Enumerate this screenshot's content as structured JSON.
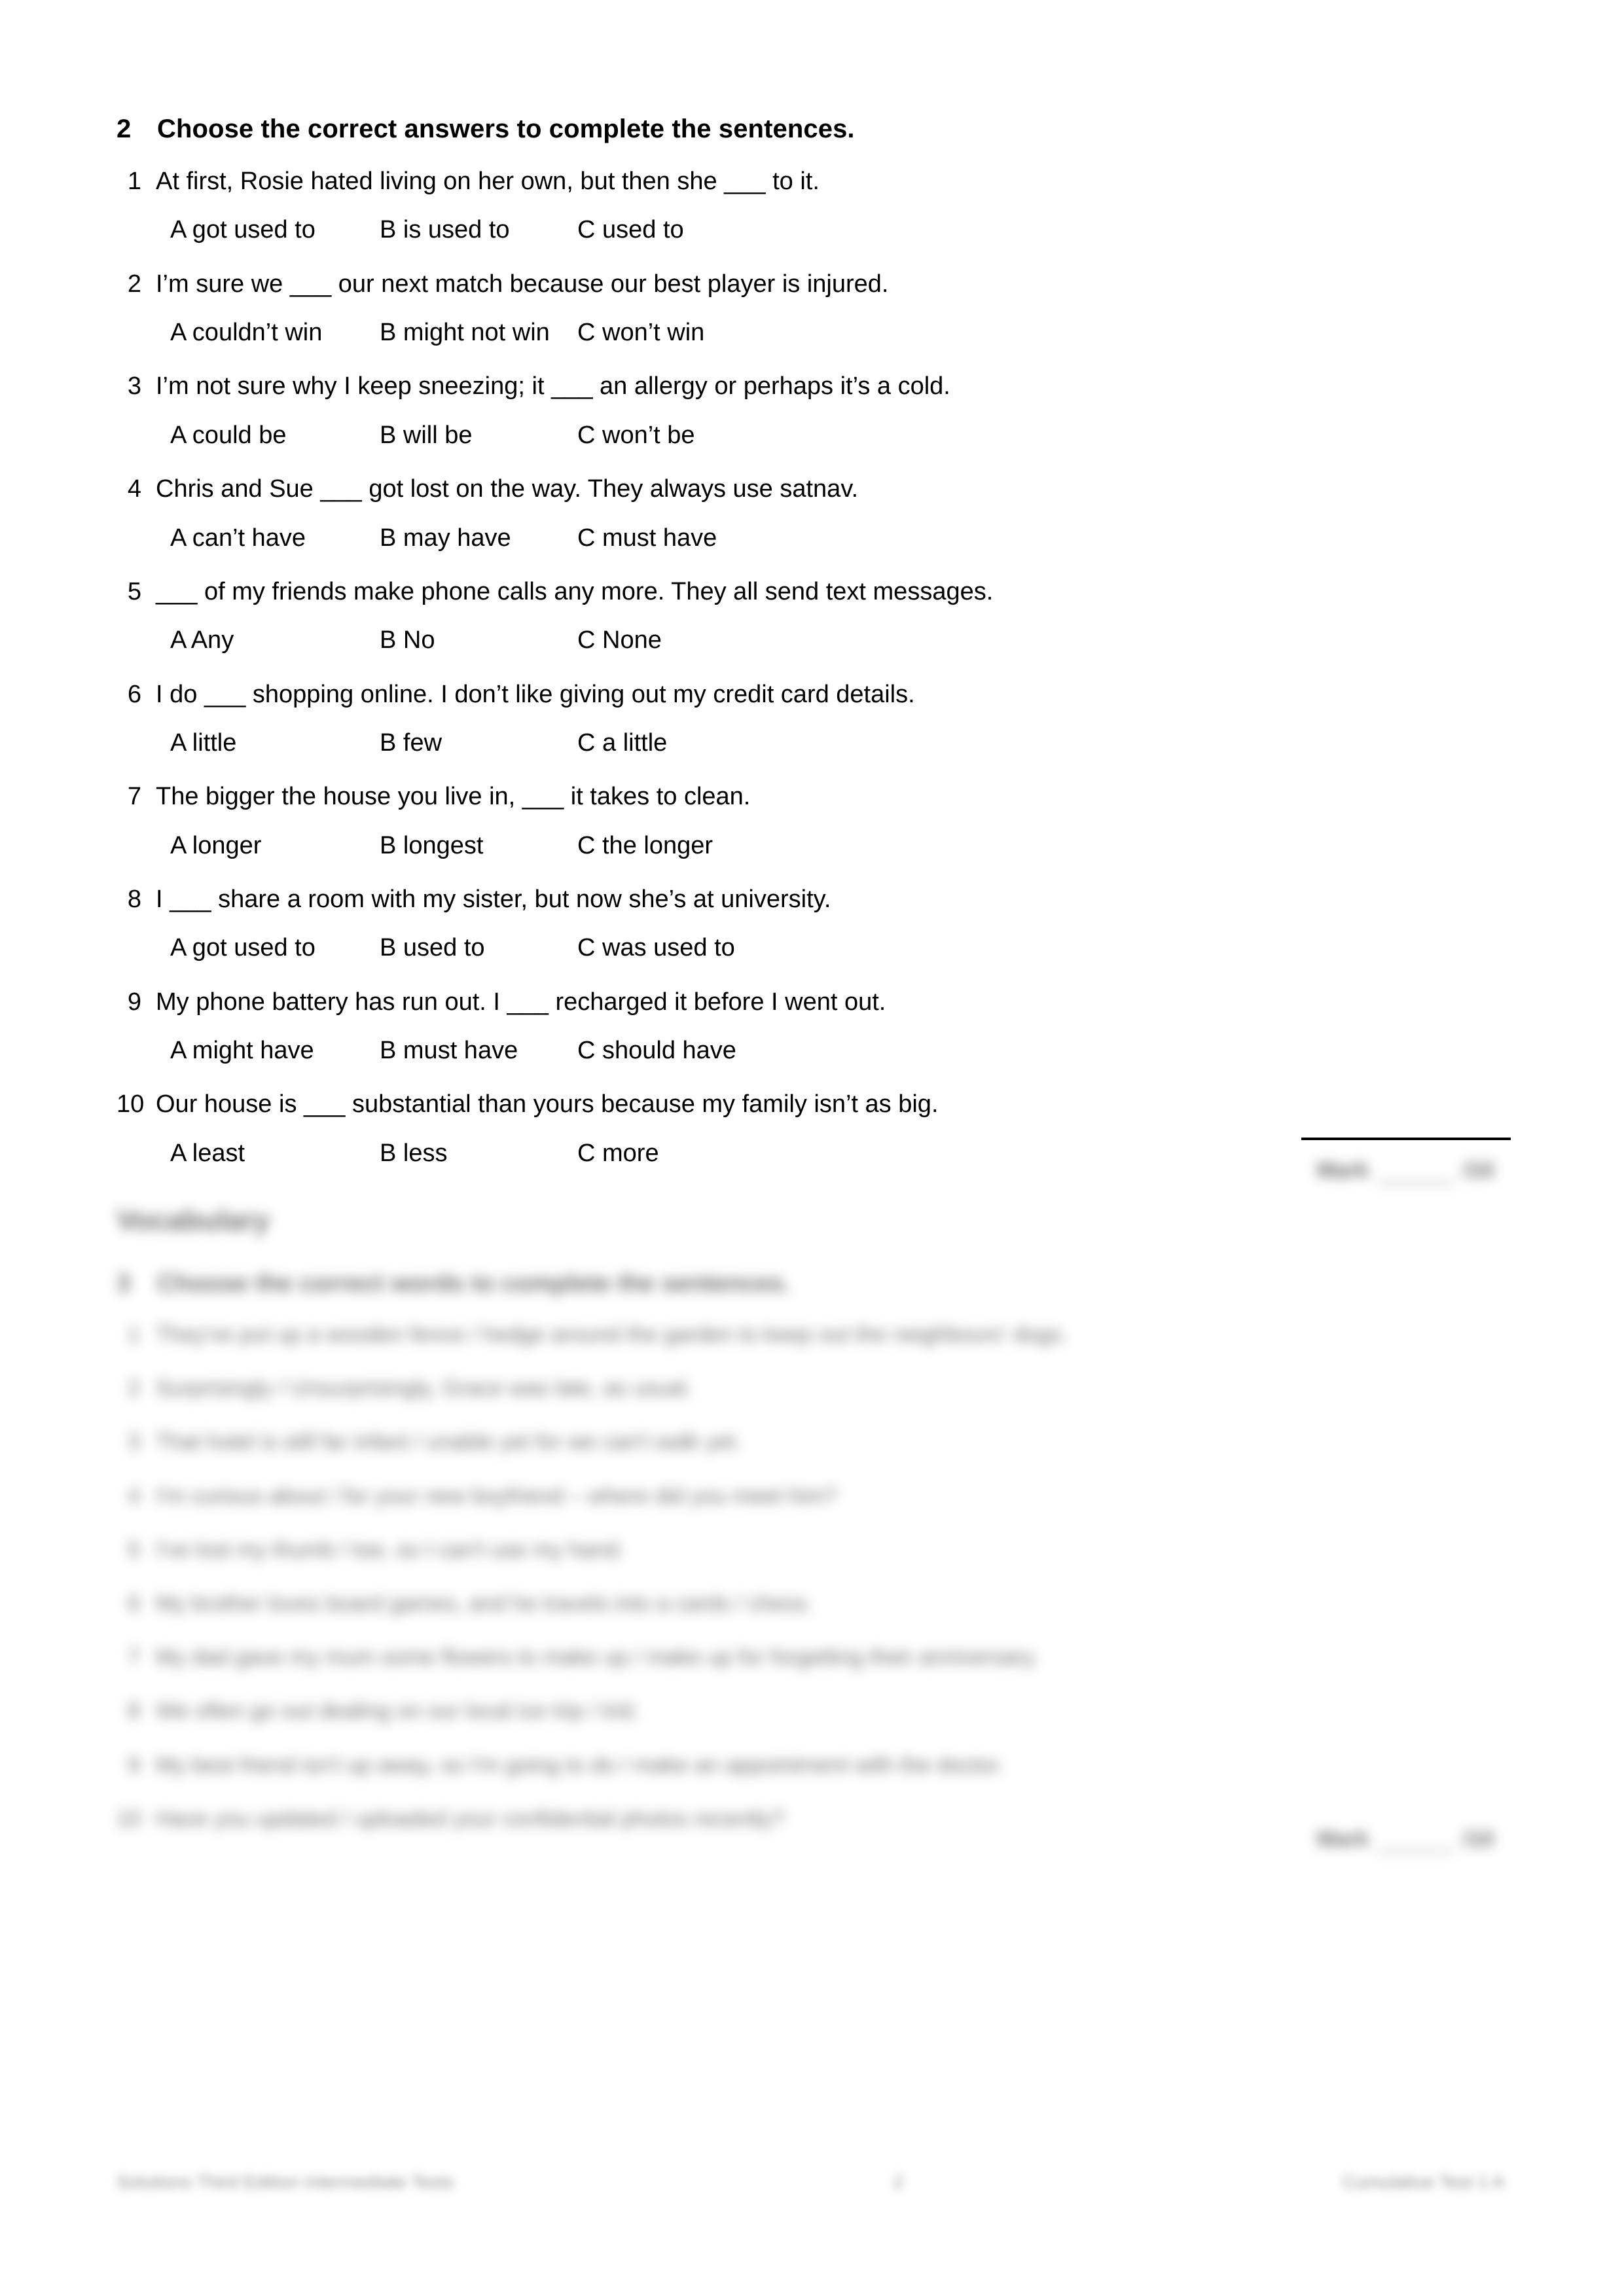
{
  "exercise2": {
    "number": "2",
    "title": "Choose the correct answers to complete the sentences.",
    "questions": [
      {
        "num": "1",
        "text": "At first, Rosie hated living on her own, but then she ___ to it.",
        "a": "A got used to",
        "b": "B is used to",
        "c": "C used to"
      },
      {
        "num": "2",
        "text": "I’m sure we ___ our next match because our best player is injured.",
        "a": "A couldn’t win",
        "b": "B might not win",
        "c": "C won’t win"
      },
      {
        "num": "3",
        "text": "I’m not sure why I keep sneezing; it ___ an allergy or perhaps it’s a cold.",
        "a": "A could be",
        "b": "B will be",
        "c": "C won’t be"
      },
      {
        "num": "4",
        "text": "Chris and Sue ___ got lost on the way. They always use satnav.",
        "a": "A can’t have",
        "b": "B may have",
        "c": "C must have"
      },
      {
        "num": "5",
        "text": "___ of my friends make phone calls any more. They all send text messages.",
        "a": "A Any",
        "b": "B No",
        "c": "C None"
      },
      {
        "num": "6",
        "text": "I do ___ shopping online. I don’t like giving out my credit card details.",
        "a": "A little",
        "b": "B few",
        "c": "C a little"
      },
      {
        "num": "7",
        "text": "The bigger the house you live in, ___ it takes to clean.",
        "a": "A longer",
        "b": "B longest",
        "c": "C the longer"
      },
      {
        "num": "8",
        "text": "I ___ share a room with my sister, but now she’s at university.",
        "a": "A got used to",
        "b": "B used to",
        "c": "C was used to"
      },
      {
        "num": "9",
        "text": "My phone battery has run out. I ___ recharged it before I went out.",
        "a": "A might have",
        "b": "B must have",
        "c": "C should have"
      },
      {
        "num": "10",
        "text": "Our house is ___ substantial than yours because my family isn’t as big.",
        "a": "A least",
        "b": "B less",
        "c": "C more"
      }
    ]
  },
  "score_box_1": {
    "label": "Mark",
    "total": "/10"
  },
  "score_box_2": {
    "label": "Mark",
    "total": "/10"
  },
  "vocabulary": {
    "title": "Vocabulary",
    "exercise": {
      "number": "3",
      "title": "Choose the correct words to complete the sentences."
    },
    "items": [
      {
        "num": "1",
        "text": "They've put up a wooden fence / hedge around the garden to keep out the neighbours' dogs."
      },
      {
        "num": "2",
        "text": "Surprisingly / Unsurprisingly, Grace was late, as usual."
      },
      {
        "num": "3",
        "text": "That hotel is still far infant / unable yet for we can't walk yet."
      },
      {
        "num": "4",
        "text": "I'm curious about / for your new boyfriend – where did you meet him?"
      },
      {
        "num": "5",
        "text": "I've lost my thumb / toe, so I can't use my hand."
      },
      {
        "num": "6",
        "text": "My brother loves board games, and he travels into a cards / chess."
      },
      {
        "num": "7",
        "text": "My dad gave my mum some flowers to make up / make up for forgetting their anniversary."
      },
      {
        "num": "8",
        "text": "We often go out dealing on our local ice trip / trid."
      },
      {
        "num": "9",
        "text": "My best friend isn't up away, so I'm going to do / make an appointment with the doctor."
      },
      {
        "num": "10",
        "text": "Have you updated / uploaded your confidential photos recently?"
      }
    ]
  },
  "footer": {
    "left": "Solutions Third Edition Intermediate Tests",
    "center": "2",
    "right": "Cumulative Test 1 A"
  }
}
